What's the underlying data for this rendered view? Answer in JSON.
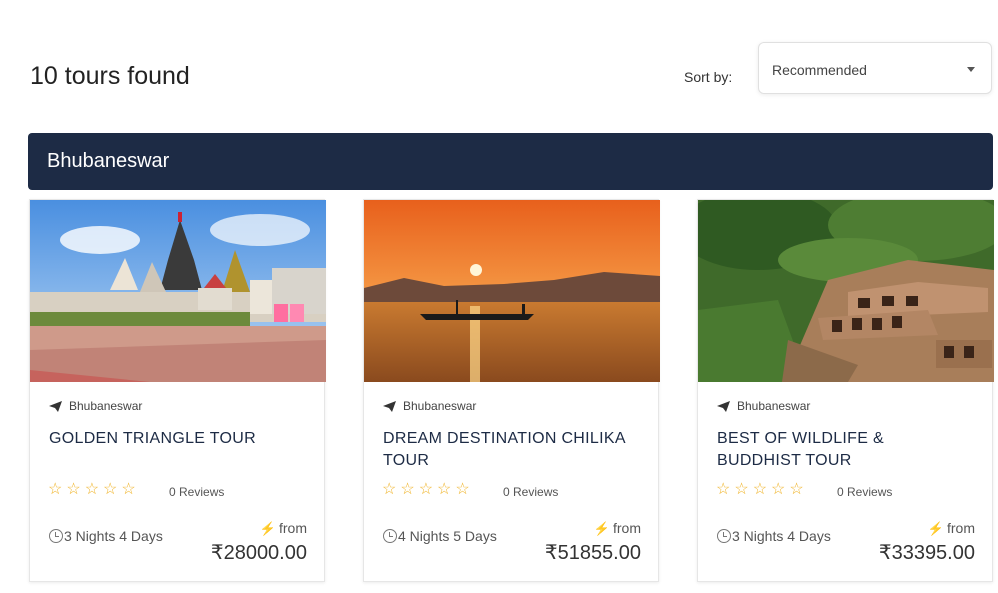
{
  "results": {
    "count_text": "10 tours found"
  },
  "sort": {
    "label": "Sort by:",
    "selected": "Recommended"
  },
  "city": {
    "name": "Bhubaneswar"
  },
  "tours": [
    {
      "location": "Bhubaneswar",
      "title": "GOLDEN TRIANGLE TOUR",
      "rating": 0,
      "reviews": "0 Reviews",
      "duration": "3 Nights 4 Days",
      "from_label": "from",
      "price": "₹28000.00",
      "image": "temple-photo"
    },
    {
      "location": "Bhubaneswar",
      "title": "DREAM DESTINATION CHILIKA TOUR",
      "rating": 0,
      "reviews": "0 Reviews",
      "duration": "4 Nights 5 Days",
      "from_label": "from",
      "price": "₹51855.00",
      "image": "sunset-lake-photo"
    },
    {
      "location": "Bhubaneswar",
      "title": "BEST OF WILDLIFE & BUDDHIST TOUR",
      "rating": 0,
      "reviews": "0 Reviews",
      "duration": "3 Nights 4 Days",
      "from_label": "from",
      "price": "₹33395.00",
      "image": "rock-caves-photo"
    }
  ],
  "colors": {
    "city_bar": "#1d2b45",
    "star": "#f0b429",
    "title": "#1d2b45",
    "bolt": "#f0a020"
  }
}
